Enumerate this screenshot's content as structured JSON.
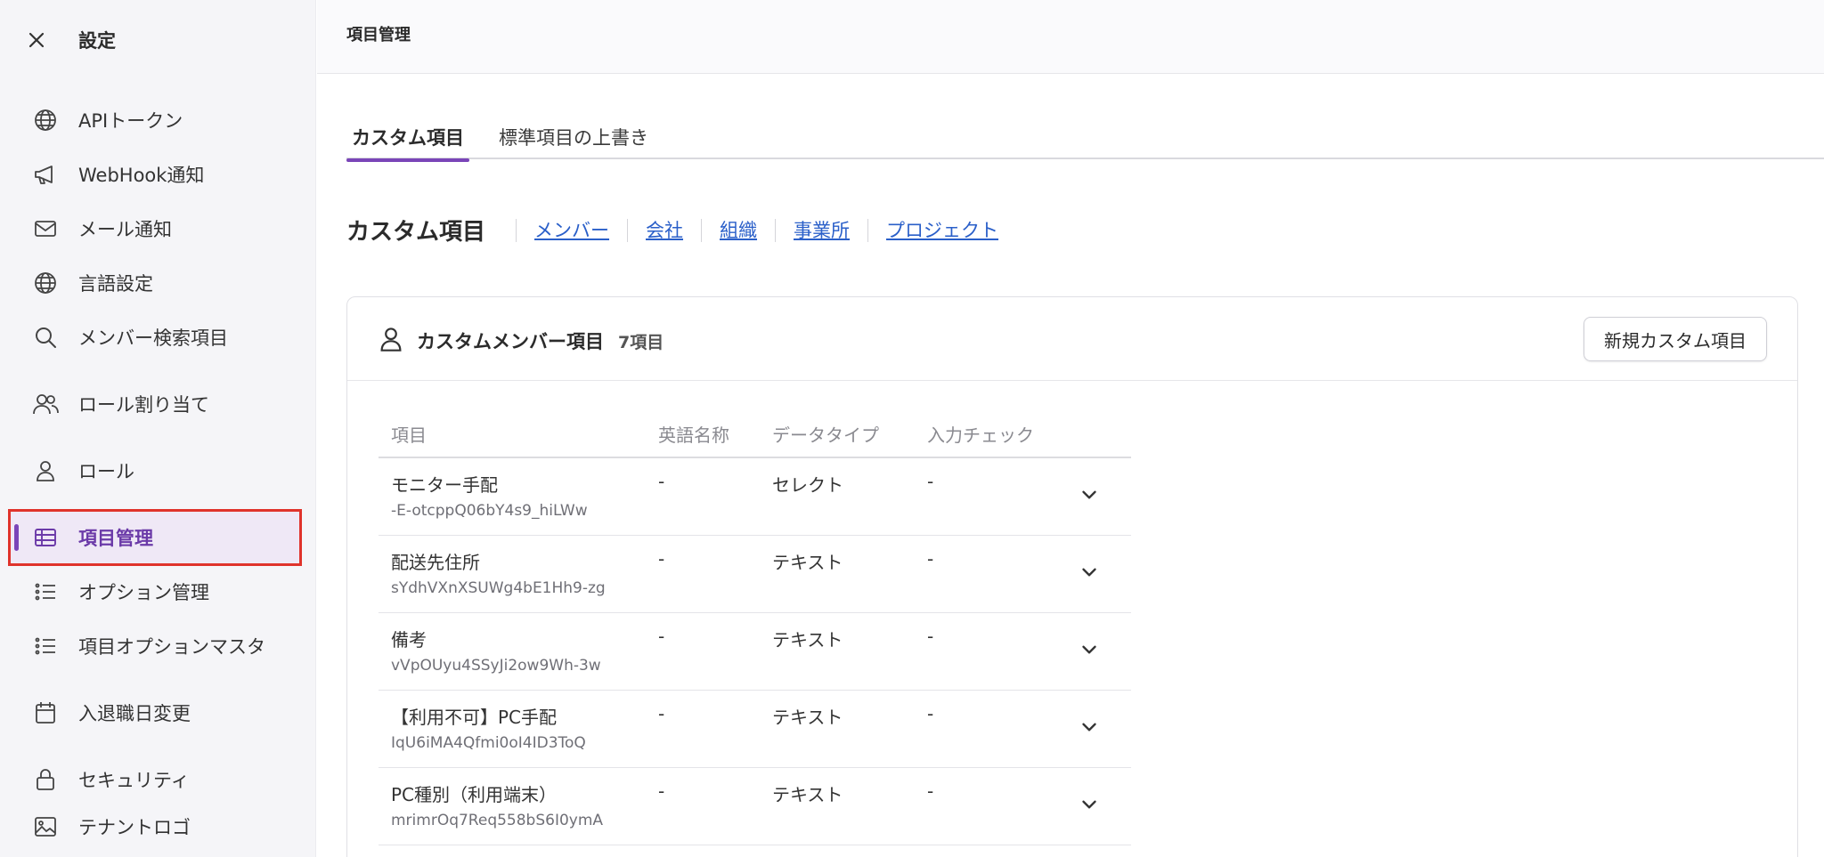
{
  "sidebar": {
    "title": "設定",
    "items": [
      {
        "label": "APIトークン",
        "icon": "globe-icon"
      },
      {
        "label": "WebHook通知",
        "icon": "megaphone-icon"
      },
      {
        "label": "メール通知",
        "icon": "mail-icon"
      },
      {
        "label": "言語設定",
        "icon": "globe-icon"
      },
      {
        "label": "メンバー検索項目",
        "icon": "search-icon"
      },
      {
        "label": "ロール割り当て",
        "icon": "users-icon"
      },
      {
        "label": "ロール",
        "icon": "person-icon"
      },
      {
        "label": "項目管理",
        "icon": "table-icon",
        "active": true
      },
      {
        "label": "オプション管理",
        "icon": "list-icon"
      },
      {
        "label": "項目オプションマスタ",
        "icon": "list-icon"
      },
      {
        "label": "入退職日変更",
        "icon": "calendar-icon"
      },
      {
        "label": "セキュリティ",
        "icon": "lock-icon"
      },
      {
        "label": "テナントロゴ",
        "icon": "image-icon"
      }
    ]
  },
  "header": {
    "title": "項目管理"
  },
  "tabs": [
    {
      "label": "カスタム項目",
      "active": true
    },
    {
      "label": "標準項目の上書き",
      "active": false
    }
  ],
  "section": {
    "title": "カスタム項目",
    "links": [
      "メンバー",
      "会社",
      "組織",
      "事業所",
      "プロジェクト"
    ]
  },
  "card": {
    "title": "カスタムメンバー項目",
    "count": "7項目",
    "new_button": "新規カスタム項目",
    "columns": [
      "項目",
      "英語名称",
      "データタイプ",
      "入力チェック"
    ],
    "rows": [
      {
        "name": "モニター手配",
        "id": "-E-otcppQ06bY4s9_hiLWw",
        "english": "-",
        "type": "セレクト",
        "check": "-"
      },
      {
        "name": "配送先住所",
        "id": "sYdhVXnXSUWg4bE1Hh9-zg",
        "english": "-",
        "type": "テキスト",
        "check": "-"
      },
      {
        "name": "備考",
        "id": "vVpOUyu4SSyJi2ow9Wh-3w",
        "english": "-",
        "type": "テキスト",
        "check": "-"
      },
      {
        "name": "【利用不可】PC手配",
        "id": "IqU6iMA4Qfmi0oI4ID3ToQ",
        "english": "-",
        "type": "テキスト",
        "check": "-"
      },
      {
        "name": "PC種別（利用端末）",
        "id": "mrimrOq7Req558bS6I0ymA",
        "english": "-",
        "type": "テキスト",
        "check": "-"
      }
    ]
  },
  "colors": {
    "accent": "#7a45b8",
    "link": "#2a5fc9",
    "highlight": "#e0332b"
  }
}
